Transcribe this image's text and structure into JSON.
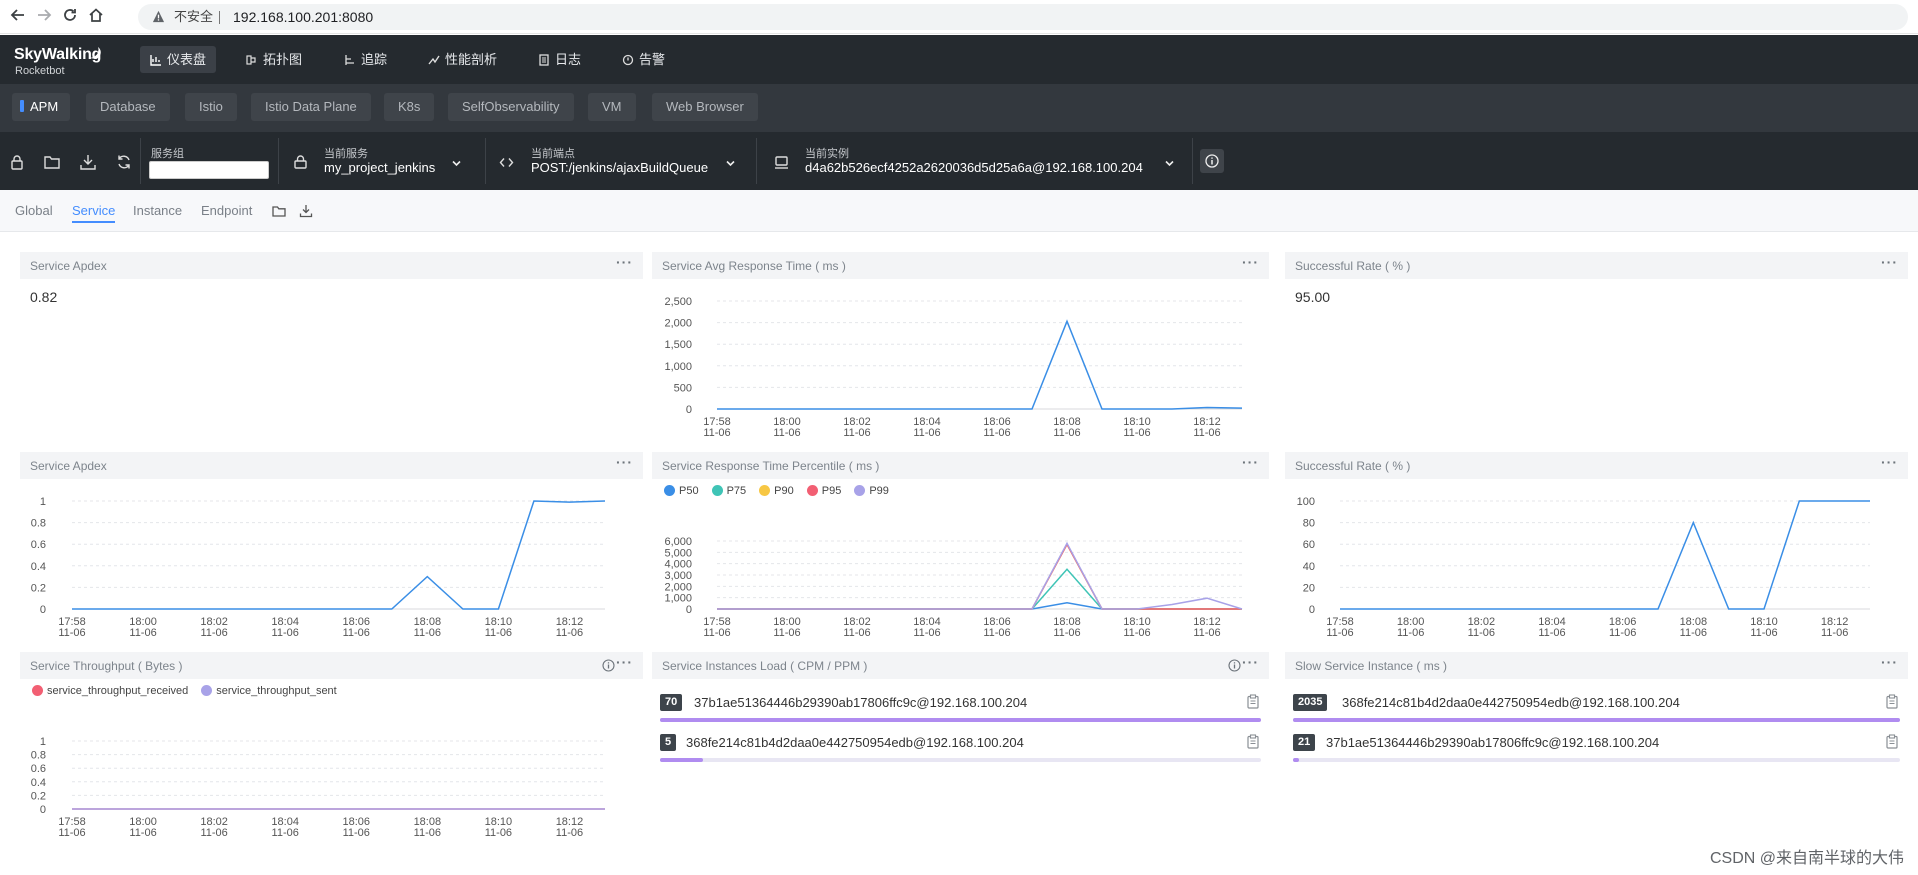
{
  "browser": {
    "security_warning": "不安全",
    "url": "192.168.100.201:8080"
  },
  "app": {
    "logo_name": "SkyWalking",
    "logo_sub": "Rocketbot",
    "nav": [
      {
        "label": "仪表盘",
        "icon": "dashboard-icon",
        "active": true
      },
      {
        "label": "拓扑图",
        "icon": "topology-icon"
      },
      {
        "label": "追踪",
        "icon": "trace-icon"
      },
      {
        "label": "性能剖析",
        "icon": "profile-icon"
      },
      {
        "label": "日志",
        "icon": "log-icon"
      },
      {
        "label": "告警",
        "icon": "alarm-icon"
      }
    ]
  },
  "layers": {
    "tabs": [
      "APM",
      "Database",
      "Istio",
      "Istio Data Plane",
      "K8s",
      "SelfObservability",
      "VM",
      "Web Browser"
    ],
    "active": "APM"
  },
  "selectors": {
    "group_label": "服务组",
    "group_value": "",
    "service_label": "当前服务",
    "service_value": "my_project_jenkins",
    "endpoint_label": "当前端点",
    "endpoint_value": "POST:/jenkins/ajaxBuildQueue",
    "instance_label": "当前实例",
    "instance_value": "d4a62b526ecf4252a2620036d5d25a6a@192.168.100.204"
  },
  "dashboard_tabs": {
    "tabs": [
      "Global",
      "Service",
      "Instance",
      "Endpoint"
    ],
    "active": "Service"
  },
  "panels": {
    "apdex_value": {
      "title": "Service Apdex",
      "value": "0.82"
    },
    "avg_response": {
      "title": "Service Avg Response Time ( ms )"
    },
    "success_value": {
      "title": "Successful Rate ( % )",
      "value": "95.00"
    },
    "apdex_chart": {
      "title": "Service Apdex"
    },
    "percentile": {
      "title": "Service Response Time Percentile ( ms )"
    },
    "success_chart": {
      "title": "Successful Rate ( % )"
    },
    "throughput": {
      "title": "Service Throughput ( Bytes )"
    },
    "instances_load": {
      "title": "Service Instances Load ( CPM / PPM )"
    },
    "slow_instance": {
      "title": "Slow Service Instance ( ms )"
    }
  },
  "instances_load_rows": [
    {
      "value": "70",
      "name": "37b1ae51364446b29390ab17806ffc9c@192.168.100.204",
      "ratio": 1.0
    },
    {
      "value": "5",
      "name": "368fe214c81b4d2daa0e442750954edb@192.168.100.204",
      "ratio": 0.0714
    }
  ],
  "slow_instance_rows": [
    {
      "value": "2035",
      "name": "368fe214c81b4d2daa0e442750954edb@192.168.100.204",
      "ratio": 1.0
    },
    {
      "value": "21",
      "name": "37b1ae51364446b29390ab17806ffc9c@192.168.100.204",
      "ratio": 0.0103
    }
  ],
  "colors": {
    "blue": "#3a8ee6",
    "teal": "#3fc4b6",
    "yellow": "#f7c744",
    "red": "#f25f73",
    "purple": "#a8a2e8",
    "accent": "#448dfe"
  },
  "chart_data": [
    {
      "id": "avg_response",
      "type": "line",
      "title": "Service Avg Response Time ( ms )",
      "x": [
        "17:58\n11-06",
        "18:00\n11-06",
        "18:02\n11-06",
        "18:04\n11-06",
        "18:06\n11-06",
        "18:08\n11-06",
        "18:10\n11-06",
        "18:12\n11-06"
      ],
      "ylim": [
        0,
        2500
      ],
      "yticks": [
        0,
        500,
        1000,
        1500,
        2000,
        2500
      ],
      "ytick_labels": [
        "0",
        "500",
        "1,000",
        "1,500",
        "2,000",
        "2,500"
      ],
      "series": [
        {
          "values": [
            0,
            0,
            0,
            0,
            0,
            0,
            0,
            0,
            0,
            0,
            2030,
            0,
            0,
            0,
            35,
            20
          ],
          "color": "#3a8ee6"
        }
      ],
      "grid": true
    },
    {
      "id": "apdex_chart",
      "type": "line",
      "title": "Service Apdex",
      "x": [
        "17:58\n11-06",
        "18:00\n11-06",
        "18:02\n11-06",
        "18:04\n11-06",
        "18:06\n11-06",
        "18:08\n11-06",
        "18:10\n11-06",
        "18:12\n11-06"
      ],
      "ylim": [
        0,
        1
      ],
      "yticks": [
        0,
        0.2,
        0.4,
        0.6,
        0.8,
        1
      ],
      "ytick_labels": [
        "0",
        "0.2",
        "0.4",
        "0.6",
        "0.8",
        "1"
      ],
      "series": [
        {
          "values": [
            0,
            0,
            0,
            0,
            0,
            0,
            0,
            0,
            0,
            0,
            0.3,
            0,
            0,
            1,
            0.99,
            1
          ],
          "color": "#3a8ee6"
        }
      ],
      "grid": true
    },
    {
      "id": "percentile",
      "type": "line",
      "title": "Service Response Time Percentile ( ms )",
      "x": [
        "17:58\n11-06",
        "18:00\n11-06",
        "18:02\n11-06",
        "18:04\n11-06",
        "18:06\n11-06",
        "18:08\n11-06",
        "18:10\n11-06",
        "18:12\n11-06"
      ],
      "ylim": [
        0,
        6000
      ],
      "yticks": [
        0,
        1000,
        2000,
        3000,
        4000,
        5000,
        6000
      ],
      "ytick_labels": [
        "0",
        "1,000",
        "2,000",
        "3,000",
        "4,000",
        "5,000",
        "6,000"
      ],
      "legend_position": "top-left",
      "series": [
        {
          "name": "P50",
          "color": "#3a8ee6",
          "values": [
            0,
            0,
            0,
            0,
            0,
            0,
            0,
            0,
            0,
            0,
            550,
            0,
            0,
            0,
            0,
            0
          ]
        },
        {
          "name": "P75",
          "color": "#3fc4b6",
          "values": [
            0,
            0,
            0,
            0,
            0,
            0,
            0,
            0,
            0,
            0,
            3500,
            0,
            0,
            0,
            0,
            0
          ]
        },
        {
          "name": "P90",
          "color": "#f7c744",
          "values": [
            0,
            0,
            0,
            0,
            0,
            0,
            0,
            0,
            0,
            0,
            5700,
            0,
            0,
            0,
            0,
            0
          ]
        },
        {
          "name": "P95",
          "color": "#f25f73",
          "values": [
            0,
            0,
            0,
            0,
            0,
            0,
            0,
            0,
            0,
            0,
            5700,
            0,
            0,
            0,
            0,
            0
          ]
        },
        {
          "name": "P99",
          "color": "#a8a2e8",
          "values": [
            0,
            0,
            0,
            0,
            0,
            0,
            0,
            0,
            0,
            0,
            5800,
            0,
            0,
            400,
            950,
            0
          ]
        }
      ],
      "grid": true
    },
    {
      "id": "success_chart",
      "type": "line",
      "title": "Successful Rate ( % )",
      "x": [
        "17:58\n11-06",
        "18:00\n11-06",
        "18:02\n11-06",
        "18:04\n11-06",
        "18:06\n11-06",
        "18:08\n11-06",
        "18:10\n11-06",
        "18:12\n11-06"
      ],
      "ylim": [
        0,
        100
      ],
      "yticks": [
        0,
        20,
        40,
        60,
        80,
        100
      ],
      "ytick_labels": [
        "0",
        "20",
        "40",
        "60",
        "80",
        "100"
      ],
      "series": [
        {
          "values": [
            0,
            0,
            0,
            0,
            0,
            0,
            0,
            0,
            0,
            0,
            80,
            0,
            0,
            100,
            100,
            100
          ],
          "color": "#3a8ee6"
        }
      ],
      "grid": true
    },
    {
      "id": "throughput",
      "type": "line",
      "title": "Service Throughput ( Bytes )",
      "x": [
        "17:58\n11-06",
        "18:00\n11-06",
        "18:02\n11-06",
        "18:04\n11-06",
        "18:06\n11-06",
        "18:08\n11-06",
        "18:10\n11-06",
        "18:12\n11-06"
      ],
      "ylim": [
        0,
        1
      ],
      "yticks": [
        0,
        0.2,
        0.4,
        0.6,
        0.8,
        1
      ],
      "ytick_labels": [
        "0",
        "0.2",
        "0.4",
        "0.6",
        "0.8",
        "1"
      ],
      "legend_position": "top-left",
      "series": [
        {
          "name": "service_throughput_received",
          "color": "#f25f73",
          "values": [
            0,
            0,
            0,
            0,
            0,
            0,
            0,
            0,
            0,
            0,
            0,
            0,
            0,
            0,
            0,
            0
          ]
        },
        {
          "name": "service_throughput_sent",
          "color": "#a8a2e8",
          "values": [
            0,
            0,
            0,
            0,
            0,
            0,
            0,
            0,
            0,
            0,
            0,
            0,
            0,
            0,
            0,
            0
          ]
        }
      ],
      "grid": true
    }
  ],
  "footer": {
    "watermark": "CSDN @来自南半球的大伟"
  }
}
